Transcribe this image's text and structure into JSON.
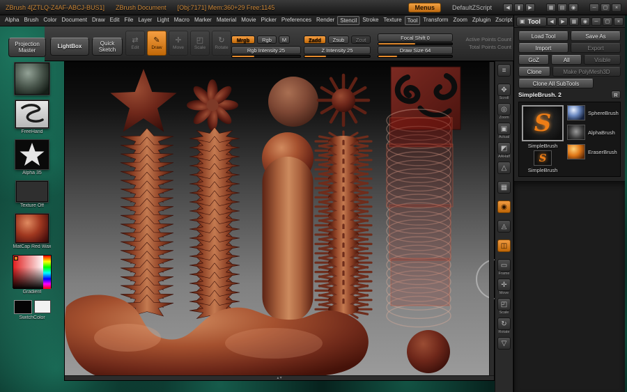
{
  "colors": {
    "accent_orange": "#e0802a",
    "wax_red": "#a5512f",
    "background_teal": "#0e4a3c"
  },
  "title_bar": {
    "app_title": "ZBrush 4[ZTLQ-Z4AF-ABCJ-BUS1]",
    "document_title": "ZBrush Document",
    "stats": "[Obj:7171] Mem:360+29 Free:1145",
    "menus_button": "Menus",
    "zscript_label": "DefaultZScript",
    "nav_icons": [
      "◀",
      "▮",
      "▶"
    ],
    "tool_icons": [
      "▦",
      "▤",
      "◉"
    ],
    "window_icons": [
      "─",
      "▢",
      "×"
    ]
  },
  "menu_bar": {
    "items": [
      {
        "label": "Alpha"
      },
      {
        "label": "Brush"
      },
      {
        "label": "Color"
      },
      {
        "label": "Document"
      },
      {
        "label": "Draw"
      },
      {
        "label": "Edit"
      },
      {
        "label": "File"
      },
      {
        "label": "Layer"
      },
      {
        "label": "Light"
      },
      {
        "label": "Macro"
      },
      {
        "label": "Marker"
      },
      {
        "label": "Material"
      },
      {
        "label": "Movie"
      },
      {
        "label": "Picker"
      },
      {
        "label": "Preferences"
      },
      {
        "label": "Render"
      },
      {
        "label": "Stencil",
        "framed": true
      },
      {
        "label": "Stroke"
      },
      {
        "label": "Texture"
      },
      {
        "label": "Tool",
        "framed": true
      },
      {
        "label": "Transform"
      },
      {
        "label": "Zoom"
      },
      {
        "label": "Zplugin"
      },
      {
        "label": "Zscript"
      }
    ]
  },
  "tray": {
    "win_icons": [
      "◀",
      "▶",
      "▦",
      "◉",
      "─",
      "▢",
      "×"
    ]
  },
  "toolbar": {
    "projection_master": "Projection Master",
    "lightbox": "LightBox",
    "quick_sketch": "Quick Sketch",
    "modes": [
      {
        "label": "Edit",
        "glyph": "⇄",
        "dim": true
      },
      {
        "label": "Draw",
        "glyph": "✎",
        "active": true
      },
      {
        "label": "Move",
        "glyph": "✛",
        "dim": true
      },
      {
        "label": "Scale",
        "glyph": "◰",
        "dim": true
      },
      {
        "label": "Rotate",
        "glyph": "↻",
        "dim": true
      }
    ],
    "mrgb": "Mrgb",
    "rgb": "Rgb",
    "m": "M",
    "zadd": "Zadd",
    "zsub": "Zsub",
    "zcut": "Zcut",
    "rgb_intensity": "Rgb Intensity 25",
    "z_intensity": "Z Intensity 25",
    "focal_shift": "Focal Shift 0",
    "draw_size": "Draw Size 64",
    "fills": {
      "rgb": 33,
      "z": 33,
      "focal": 50,
      "draw": 25
    },
    "active_points": "Active Points Count",
    "total_points": "Total Points Count"
  },
  "left_sidebar": {
    "stroke_label": "FreeHand",
    "alpha_label": "Alpha 35",
    "texture_label": "Texture Off",
    "material_label": "MatCap Red Wax",
    "gradient_label": "Gradient",
    "switch_label": "SwitchColor"
  },
  "right_shelf": {
    "items": [
      {
        "name": "shelf-divider-icon",
        "glyph": "≡",
        "label": ""
      },
      {
        "name": "scroll-icon",
        "glyph": "✥",
        "label": "Scroll"
      },
      {
        "name": "zoom-icon",
        "glyph": "◎",
        "label": "Zoom"
      },
      {
        "name": "actual-icon",
        "glyph": "▣",
        "label": "Actual"
      },
      {
        "name": "aahalf-icon",
        "glyph": "◩",
        "label": "AAHalf"
      },
      {
        "name": "persp-icon",
        "glyph": "△",
        "label": ""
      },
      {
        "name": "floor-icon",
        "glyph": "▦",
        "label": ""
      },
      {
        "name": "local-icon",
        "glyph": "◉",
        "label": "",
        "orange": true
      },
      {
        "name": "lsym-icon",
        "glyph": "◬",
        "label": ""
      },
      {
        "name": "solo-icon",
        "glyph": "◫",
        "label": "",
        "orange": true
      },
      {
        "name": "frame-icon",
        "glyph": "▭",
        "label": "Frame"
      },
      {
        "name": "move-icon",
        "glyph": "✛",
        "label": "Move"
      },
      {
        "name": "scale-icon",
        "glyph": "◰",
        "label": "Scale"
      },
      {
        "name": "rotate-icon",
        "glyph": "↻",
        "label": "Rotate"
      },
      {
        "name": "dock-icon",
        "glyph": "▽",
        "label": ""
      }
    ]
  },
  "tool_panel": {
    "title": "Tool",
    "load_tool": "Load Tool",
    "save_as": "Save As",
    "import": "Import",
    "export": "Export",
    "goz": "GoZ",
    "goz_all": "All",
    "goz_visible": "Visible",
    "clone": "Clone",
    "make_polymesh": "Make PolyMesh3D",
    "clone_subtools": "Clone All SubTools",
    "current_tool": "SimpleBrush. 2",
    "restore_button": "R",
    "thumbs": {
      "s_glyph": "S",
      "selected_caption": "SimpleBrush",
      "sphere": "SphereBrush",
      "alpha": "AlphaBrush",
      "simple": "SimpleBrush",
      "eraser": "EraserBrush"
    }
  },
  "canvas": {
    "scroll_marks": "▴ ▾"
  }
}
